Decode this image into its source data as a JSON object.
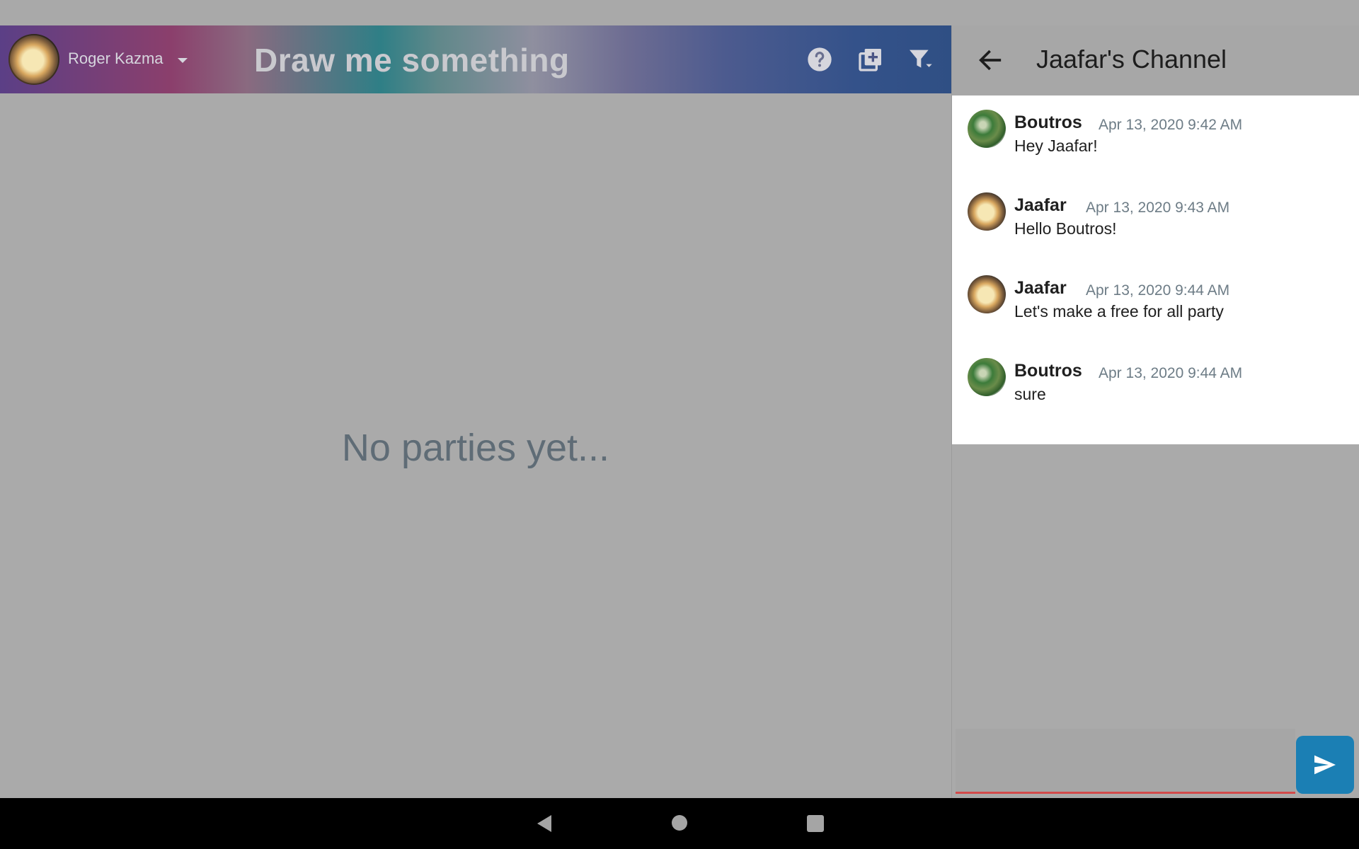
{
  "app": {
    "user_name": "Roger Kazma",
    "title": "Draw me something",
    "empty_state": "No parties yet...",
    "toolbar_icons": [
      "help-icon",
      "add-box-icon",
      "filter-icon"
    ]
  },
  "chat": {
    "channel_title": "Jaafar's Channel",
    "messages": [
      {
        "author": "Boutros",
        "time": "Apr 13, 2020 9:42 AM",
        "text": "Hey Jaafar!"
      },
      {
        "author": "Jaafar",
        "time": "Apr 13, 2020 9:43 AM",
        "text": "Hello Boutros!"
      },
      {
        "author": "Jaafar",
        "time": "Apr 13, 2020 9:44 AM",
        "text": "Let's make a free for all party"
      },
      {
        "author": "Boutros",
        "time": "Apr 13, 2020 9:44 AM",
        "text": "sure"
      }
    ],
    "composer": {
      "value": "",
      "placeholder": ""
    }
  },
  "colors": {
    "send_button": "#1b7fb4",
    "input_underline": "#d34b4b",
    "timestamp": "#6d7c86",
    "empty_state": "#5f6c76"
  },
  "system_nav": [
    "back-icon",
    "home-icon",
    "recents-icon"
  ]
}
